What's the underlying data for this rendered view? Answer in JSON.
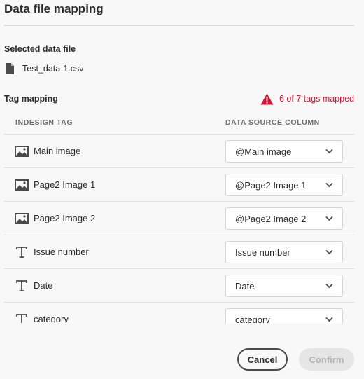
{
  "dialog": {
    "title": "Data file mapping",
    "selected_file_label": "Selected data file",
    "file_name": "Test_data-1.csv",
    "tag_mapping_label": "Tag mapping",
    "mapping_status": "6 of 7 tags mapped",
    "warning_color": "#d3152f"
  },
  "table": {
    "col_tag": "INDESIGN TAG",
    "col_source": "DATA SOURCE COLUMN",
    "rows": [
      {
        "icon": "image-icon",
        "tag": "Main image",
        "source": "@Main image"
      },
      {
        "icon": "image-icon",
        "tag": "Page2 Image 1",
        "source": "@Page2 Image 1"
      },
      {
        "icon": "image-icon",
        "tag": "Page2 Image 2",
        "source": "@Page2 Image 2"
      },
      {
        "icon": "text-icon",
        "tag": "Issue number",
        "source": "Issue number"
      },
      {
        "icon": "text-icon",
        "tag": "Date",
        "source": "Date"
      },
      {
        "icon": "text-icon",
        "tag": "category",
        "source": "category"
      }
    ]
  },
  "buttons": {
    "cancel": "Cancel",
    "confirm": "Confirm"
  }
}
